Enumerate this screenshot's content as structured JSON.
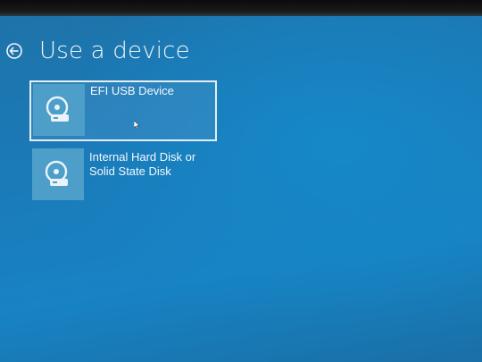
{
  "page": {
    "title": "Use a device"
  },
  "devices": [
    {
      "label_lines": [
        "EFI USB Device"
      ],
      "icon": "disk-drive-icon",
      "selected": true
    },
    {
      "label_lines": [
        "Internal Hard Disk or",
        "Solid State Disk"
      ],
      "icon": "disk-drive-icon",
      "selected": false
    }
  ],
  "colors": {
    "background": "#1b7ab8",
    "tile_icon_background": "#4d9fca",
    "selection_border": "#e6eef5",
    "text": "#ffffff"
  },
  "icons": {
    "back": "back-arrow-circle-icon",
    "device": "disk-drive-icon",
    "pointer": "mouse-pointer-icon"
  }
}
